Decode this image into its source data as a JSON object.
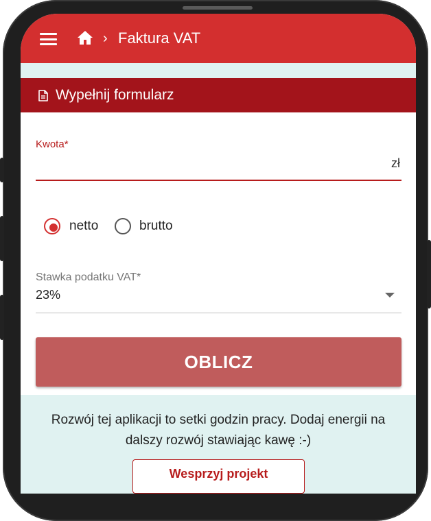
{
  "header": {
    "title": "Faktura VAT",
    "breadcrumb_separator": "›",
    "menu_icon": "hamburger-menu-icon",
    "home_icon": "home-icon",
    "color": "#d32f2f"
  },
  "section": {
    "title": "Wypełnij formularz",
    "icon": "document-icon",
    "color": "#a3141b"
  },
  "form": {
    "amount": {
      "label": "Kwota*",
      "value": "",
      "suffix": "zł"
    },
    "price_type": {
      "options": [
        {
          "label": "netto",
          "checked": true
        },
        {
          "label": "brutto",
          "checked": false
        }
      ]
    },
    "vat_rate": {
      "label": "Stawka podatku VAT*",
      "value": "23%"
    },
    "calculate_label": "OBLICZ",
    "calculate_color": "#c05c5c"
  },
  "support": {
    "message": "Rozwój tej aplikacji to setki godzin pracy. Dodaj energii na dalszy rozwój stawiając kawę :-)",
    "button_label": "Wesprzyj projekt"
  }
}
